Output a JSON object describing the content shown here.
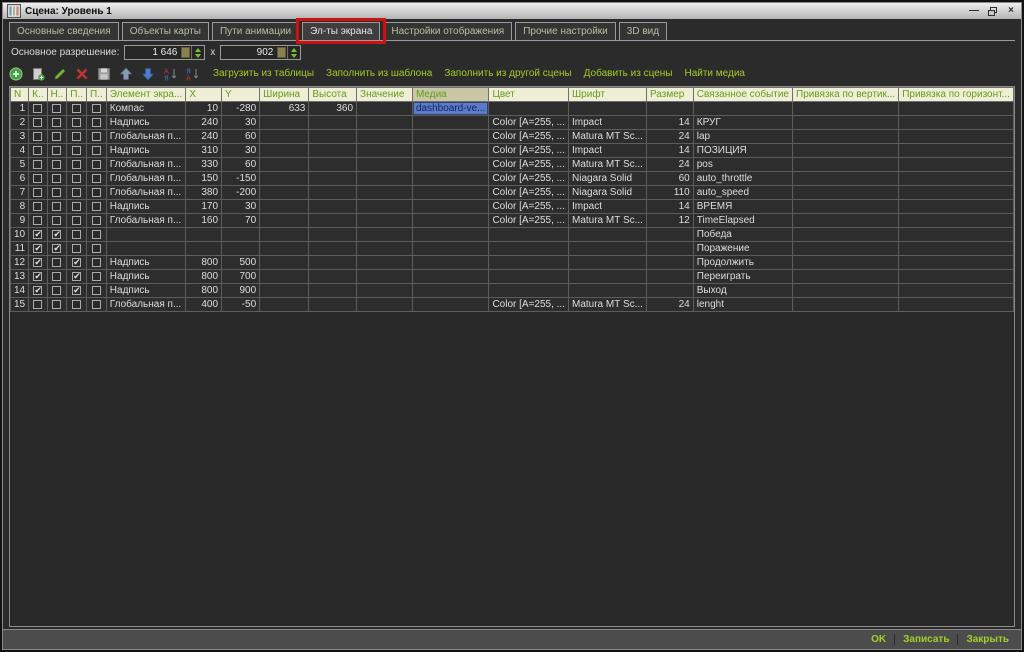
{
  "window": {
    "title": "Сцена: Уровень 1",
    "controls": {
      "minimize": "—",
      "close": "×"
    }
  },
  "tabs": {
    "items": [
      {
        "label": "Основные сведения"
      },
      {
        "label": "Объекты карты"
      },
      {
        "label": "Пути анимации"
      },
      {
        "label": "Эл-ты экрана",
        "selected": true,
        "annotated": true
      },
      {
        "label": "Настройки отображения"
      },
      {
        "label": "Прочие настройки"
      },
      {
        "label": "3D вид"
      }
    ],
    "annotation_color": "#ce1212"
  },
  "resolution": {
    "label": "Основное разрешение:",
    "width_value": "1 646",
    "separator": "x",
    "height_value": "902"
  },
  "toolbar": {
    "icons": [
      "add-icon",
      "add-page-icon",
      "edit-icon",
      "delete-icon",
      "save-icon",
      "move-up-icon",
      "move-down-icon",
      "sort-asc-icon",
      "sort-desc-icon"
    ],
    "actions": [
      "Загрузить из таблицы",
      "Заполнить из шаблона",
      "Заполнить из другой сцены",
      "Добавить из сцены",
      "Найти медиа"
    ]
  },
  "table": {
    "columns": [
      "N",
      "К..",
      "Н..",
      "П..",
      "П..",
      "Элемент экра...",
      "X",
      "Y",
      "Ширина",
      "Высота",
      "Значение",
      "Медиа",
      "Цвет",
      "Шрифт",
      "Размер",
      "Связанное событие",
      "Привязка по вертик...",
      "Привязка по горизонт..."
    ],
    "selected_column": "Медиа",
    "rows": [
      {
        "n": "1",
        "checks": [
          false,
          false,
          false,
          false
        ],
        "element": "Компас",
        "x": "10",
        "y": "-280",
        "width": "633",
        "height": "360",
        "value": "",
        "media": "dashboard-ve...",
        "media_selected": true,
        "color": "",
        "font": "",
        "size": "",
        "event": "",
        "v_anchor": "",
        "h_anchor": ""
      },
      {
        "n": "2",
        "checks": [
          false,
          false,
          false,
          false
        ],
        "element": "Надпись",
        "x": "240",
        "y": "30",
        "width": "",
        "height": "",
        "value": "",
        "media": "",
        "color": "Color [A=255, ...",
        "font": "Impact",
        "size": "14",
        "event": "КРУГ",
        "v_anchor": "",
        "h_anchor": ""
      },
      {
        "n": "3",
        "checks": [
          false,
          false,
          false,
          false
        ],
        "element": "Глобальная п...",
        "x": "240",
        "y": "60",
        "width": "",
        "height": "",
        "value": "",
        "media": "",
        "color": "Color [A=255, ...",
        "font": "Matura MT Sc...",
        "size": "24",
        "event": "lap",
        "v_anchor": "",
        "h_anchor": ""
      },
      {
        "n": "4",
        "checks": [
          false,
          false,
          false,
          false
        ],
        "element": "Надпись",
        "x": "310",
        "y": "30",
        "width": "",
        "height": "",
        "value": "",
        "media": "",
        "color": "Color [A=255, ...",
        "font": "Impact",
        "size": "14",
        "event": "ПОЗИЦИЯ",
        "v_anchor": "",
        "h_anchor": ""
      },
      {
        "n": "5",
        "checks": [
          false,
          false,
          false,
          false
        ],
        "element": "Глобальная п...",
        "x": "330",
        "y": "60",
        "width": "",
        "height": "",
        "value": "",
        "media": "",
        "color": "Color [A=255, ...",
        "font": "Matura MT Sc...",
        "size": "24",
        "event": "pos",
        "v_anchor": "",
        "h_anchor": ""
      },
      {
        "n": "6",
        "checks": [
          false,
          false,
          false,
          false
        ],
        "element": "Глобальная п...",
        "x": "150",
        "y": "-150",
        "width": "",
        "height": "",
        "value": "",
        "media": "",
        "color": "Color [A=255, ...",
        "font": "Niagara Solid",
        "size": "60",
        "event": "auto_throttle",
        "v_anchor": "",
        "h_anchor": ""
      },
      {
        "n": "7",
        "checks": [
          false,
          false,
          false,
          false
        ],
        "element": "Глобальная п...",
        "x": "380",
        "y": "-200",
        "width": "",
        "height": "",
        "value": "",
        "media": "",
        "color": "Color [A=255, ...",
        "font": "Niagara Solid",
        "size": "110",
        "event": "auto_speed",
        "v_anchor": "",
        "h_anchor": ""
      },
      {
        "n": "8",
        "checks": [
          false,
          false,
          false,
          false
        ],
        "element": "Надпись",
        "x": "170",
        "y": "30",
        "width": "",
        "height": "",
        "value": "",
        "media": "",
        "color": "Color [A=255, ...",
        "font": "Impact",
        "size": "14",
        "event": "ВРЕМЯ",
        "v_anchor": "",
        "h_anchor": ""
      },
      {
        "n": "9",
        "checks": [
          false,
          false,
          false,
          false
        ],
        "element": "Глобальная п...",
        "x": "160",
        "y": "70",
        "width": "",
        "height": "",
        "value": "",
        "media": "",
        "color": "Color [A=255, ...",
        "font": "Matura MT Sc...",
        "size": "12",
        "event": "TimeElapsed",
        "v_anchor": "",
        "h_anchor": ""
      },
      {
        "n": "10",
        "checks": [
          true,
          true,
          false,
          false
        ],
        "element": "",
        "x": "",
        "y": "",
        "width": "",
        "height": "",
        "value": "",
        "media": "",
        "color": "",
        "font": "",
        "size": "",
        "event": "Победа",
        "v_anchor": "",
        "h_anchor": ""
      },
      {
        "n": "11",
        "checks": [
          true,
          true,
          false,
          false
        ],
        "element": "",
        "x": "",
        "y": "",
        "width": "",
        "height": "",
        "value": "",
        "media": "",
        "color": "",
        "font": "",
        "size": "",
        "event": "Поражение",
        "v_anchor": "",
        "h_anchor": ""
      },
      {
        "n": "12",
        "checks": [
          true,
          false,
          true,
          false
        ],
        "element": "Надпись",
        "x": "800",
        "y": "500",
        "width": "",
        "height": "",
        "value": "",
        "media": "",
        "color": "",
        "font": "",
        "size": "",
        "event": "Продолжить",
        "v_anchor": "",
        "h_anchor": ""
      },
      {
        "n": "13",
        "checks": [
          true,
          false,
          true,
          false
        ],
        "element": "Надпись",
        "x": "800",
        "y": "700",
        "width": "",
        "height": "",
        "value": "",
        "media": "",
        "color": "",
        "font": "",
        "size": "",
        "event": "Переиграть",
        "v_anchor": "",
        "h_anchor": ""
      },
      {
        "n": "14",
        "checks": [
          true,
          false,
          true,
          false
        ],
        "element": "Надпись",
        "x": "800",
        "y": "900",
        "width": "",
        "height": "",
        "value": "",
        "media": "",
        "color": "",
        "font": "",
        "size": "",
        "event": "Выход",
        "v_anchor": "",
        "h_anchor": ""
      },
      {
        "n": "15",
        "checks": [
          false,
          false,
          false,
          false
        ],
        "element": "Глобальная п...",
        "x": "400",
        "y": "-50",
        "width": "",
        "height": "",
        "value": "",
        "media": "",
        "color": "Color [A=255, ...",
        "font": "Matura MT Sc...",
        "size": "24",
        "event": "lenght",
        "v_anchor": "",
        "h_anchor": ""
      }
    ]
  },
  "footer": {
    "buttons": [
      "OK",
      "Записать",
      "Закрыть"
    ]
  },
  "colors": {
    "accent_green": "#9ed32a",
    "toolbar_action_green": "#a6cb27",
    "header_bg": "#f0eed6",
    "header_text": "#5f9e1c",
    "selected_header_bg": "#c9c7a4",
    "selection_blue": "#5a7bc8",
    "annotation_red": "#ce1212",
    "row_bg": "#2d2d2d"
  }
}
